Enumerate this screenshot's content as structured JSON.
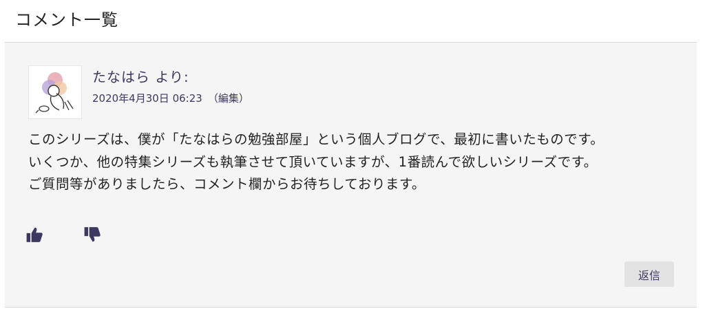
{
  "section": {
    "title": "コメント一覧"
  },
  "comment": {
    "author_line": "たなはら より:",
    "date": "2020年4月30日 06:23",
    "edit_label": "（編集）",
    "body_lines": [
      "このシリーズは、僕が「たなはらの勉強部屋」という個人ブログで、最初に書いたものです。",
      "いくつか、他の特集シリーズも執筆させて頂いていますが、1番読んで欲しいシリーズです。",
      "ご質問等がありましたら、コメント欄からお待ちしております。"
    ],
    "like_icon": "thumbs-up-icon",
    "dislike_icon": "thumbs-down-icon",
    "reply_label": "返信"
  },
  "colors": {
    "accent": "#3d3860",
    "card_background": "#f5f5f5",
    "button_background": "#e3e3e3"
  }
}
